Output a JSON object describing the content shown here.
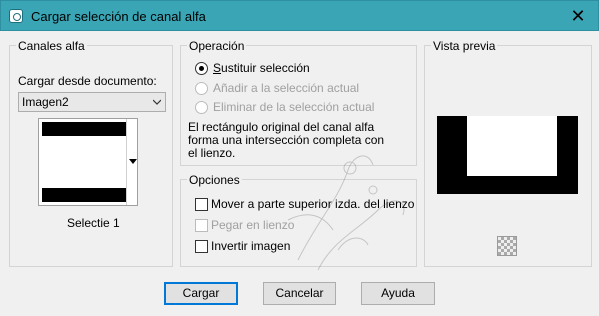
{
  "window": {
    "title": "Cargar selección de canal alfa",
    "close_glyph": "✕",
    "colors": {
      "titlebar": "#3aa5b5",
      "default_button_border": "#0078d7"
    }
  },
  "alpha_channels": {
    "group_title": "Canales alfa",
    "load_from_label": "Cargar desde documento:",
    "document_select": {
      "value": "Imagen2"
    },
    "thumbnail_caption": "Selectie 1"
  },
  "operation": {
    "group_title": "Operación",
    "options": [
      {
        "label": "Sustituir selección",
        "selected": true,
        "enabled": true
      },
      {
        "label": "Añadir a la selección actual",
        "selected": false,
        "enabled": false
      },
      {
        "label": "Eliminar de la selección actual",
        "selected": false,
        "enabled": false
      }
    ],
    "description_lines": [
      "El rectángulo original del canal alfa",
      "forma una intersección completa con",
      "el lienzo."
    ]
  },
  "options": {
    "group_title": "Opciones",
    "checkboxes": [
      {
        "label": "Mover a parte superior izda. del lienzo",
        "checked": false,
        "enabled": true
      },
      {
        "label": "Pegar en lienzo",
        "checked": false,
        "enabled": false
      },
      {
        "label": "Invertir imagen",
        "checked": false,
        "enabled": true
      }
    ]
  },
  "preview": {
    "group_title": "Vista previa",
    "toggle_icon": "checkerboard-icon"
  },
  "buttons": {
    "load": "Cargar",
    "cancel": "Cancelar",
    "help": "Ayuda"
  }
}
